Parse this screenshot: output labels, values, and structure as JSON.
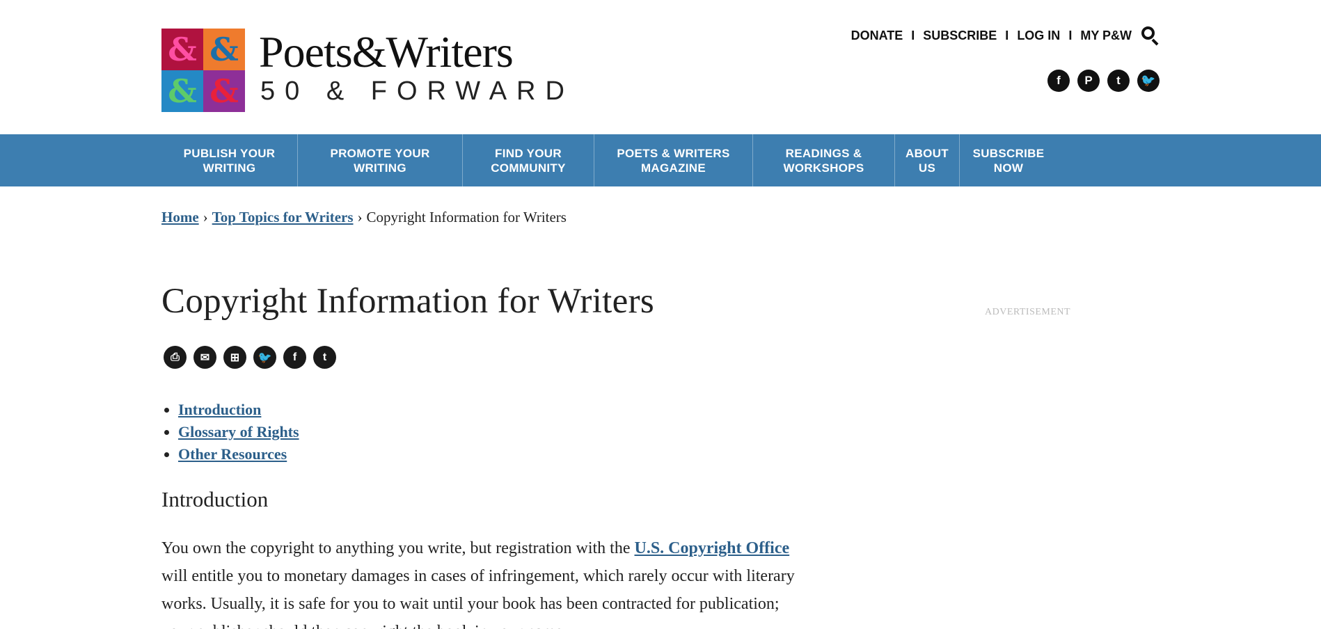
{
  "logo": {
    "title": "Poets&Writers",
    "subtitle": "50 & FORWARD",
    "cells": [
      {
        "glyph": "&",
        "bg": "#b0123f",
        "fg": "#ff4fa3"
      },
      {
        "glyph": "&",
        "bg": "#ef7b2d",
        "fg": "#1d6fa8"
      },
      {
        "glyph": "&",
        "bg": "#2489c5",
        "fg": "#5ecb6a"
      },
      {
        "glyph": "&",
        "bg": "#8e2f98",
        "fg": "#e8213b"
      }
    ]
  },
  "util_nav": {
    "donate": "DONATE",
    "subscribe": "SUBSCRIBE",
    "login": "LOG IN",
    "mypw": "MY P&W",
    "separator": "I",
    "search_icon": "search-icon"
  },
  "social_top": [
    {
      "name": "facebook-icon",
      "glyph": "f"
    },
    {
      "name": "pinterest-icon",
      "glyph": "P"
    },
    {
      "name": "tumblr-icon",
      "glyph": "t"
    },
    {
      "name": "twitter-icon",
      "glyph": "🐦"
    }
  ],
  "main_nav": [
    {
      "label": "PUBLISH YOUR\nWRITING"
    },
    {
      "label": "PROMOTE YOUR\nWRITING"
    },
    {
      "label": "FIND YOUR\nCOMMUNITY"
    },
    {
      "label": "POETS & WRITERS\nMAGAZINE"
    },
    {
      "label": "READINGS &\nWORKSHOPS"
    },
    {
      "label": "ABOUT\nUS"
    },
    {
      "label": "SUBSCRIBE\nNOW"
    }
  ],
  "breadcrumb": {
    "home": "Home",
    "topics": "Top Topics for Writers",
    "current": "Copyright Information for Writers",
    "separator": "›"
  },
  "page": {
    "title": "Copyright Information for Writers",
    "ad_label": "ADVERTISEMENT"
  },
  "share": [
    {
      "name": "print-icon",
      "glyph": "⎙"
    },
    {
      "name": "email-icon",
      "glyph": "✉"
    },
    {
      "name": "save-icon",
      "glyph": "⊞"
    },
    {
      "name": "twitter-icon",
      "glyph": "🐦"
    },
    {
      "name": "facebook-icon",
      "glyph": "f"
    },
    {
      "name": "tumblr-icon",
      "glyph": "t"
    }
  ],
  "toc": [
    "Introduction",
    "Glossary of Rights",
    "Other Resources"
  ],
  "section": {
    "heading": "Introduction",
    "para_start": "You own the copyright to anything you write, but registration with the ",
    "para_link": "U.S. Copyright Office",
    "para_rest": " will entitle you to monetary damages in cases of infringement, which rarely occur with literary works. Usually, it is safe for you to wait until your book has been contracted for publication; your publisher should then copyright the book in your name."
  },
  "colors": {
    "nav_bg": "#3d7eb0",
    "link": "#2c5f8a"
  }
}
